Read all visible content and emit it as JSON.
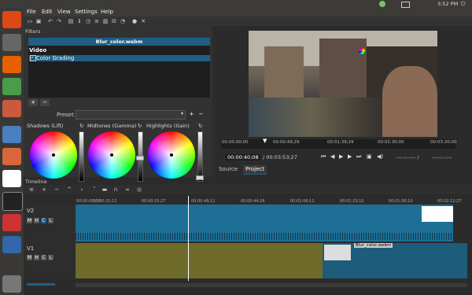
{
  "system": {
    "time": "3:52 PM"
  },
  "menubar": {
    "items": [
      "File",
      "Edit",
      "View",
      "Settings",
      "Help"
    ]
  },
  "filters": {
    "panel_title": "Filters",
    "file_name": "Blur_color.webm",
    "section_video": "Video",
    "filter_item": "Color Grading",
    "preset_label": "Preset",
    "wheels": [
      {
        "label": "Shadows (Lift)"
      },
      {
        "label": "Midtones (Gamma)"
      },
      {
        "label": "Highlights (Gain)"
      }
    ]
  },
  "viewer": {
    "ruler_ticks": [
      "00:00:00;00",
      "00:00:49;29",
      "00:01:39;29",
      "00:02:30;00",
      "00:03:20;00"
    ],
    "current_time": "00:00:40;08",
    "total_time": "/ 00:03:53;27",
    "in_out": "--:--:--:-- /",
    "in_out2": "--:--:--:--",
    "tabs": [
      "Source",
      "Project"
    ]
  },
  "timeline": {
    "title": "Timeline",
    "ticks": [
      "00:00:00;00",
      "00:00:31;12",
      "00:00:15;27",
      "00:00:49;11",
      "00:00:44;26",
      "00:01:06;11",
      "00:01:13;25",
      "00:01:23;10",
      "00:01:58;10",
      "00:02:12;27"
    ],
    "tracks": [
      {
        "name": "V2"
      },
      {
        "name": "V1"
      }
    ],
    "track_buttons": [
      "M",
      "H",
      "C",
      "L"
    ],
    "clip_label": "Blur_color.webm"
  }
}
